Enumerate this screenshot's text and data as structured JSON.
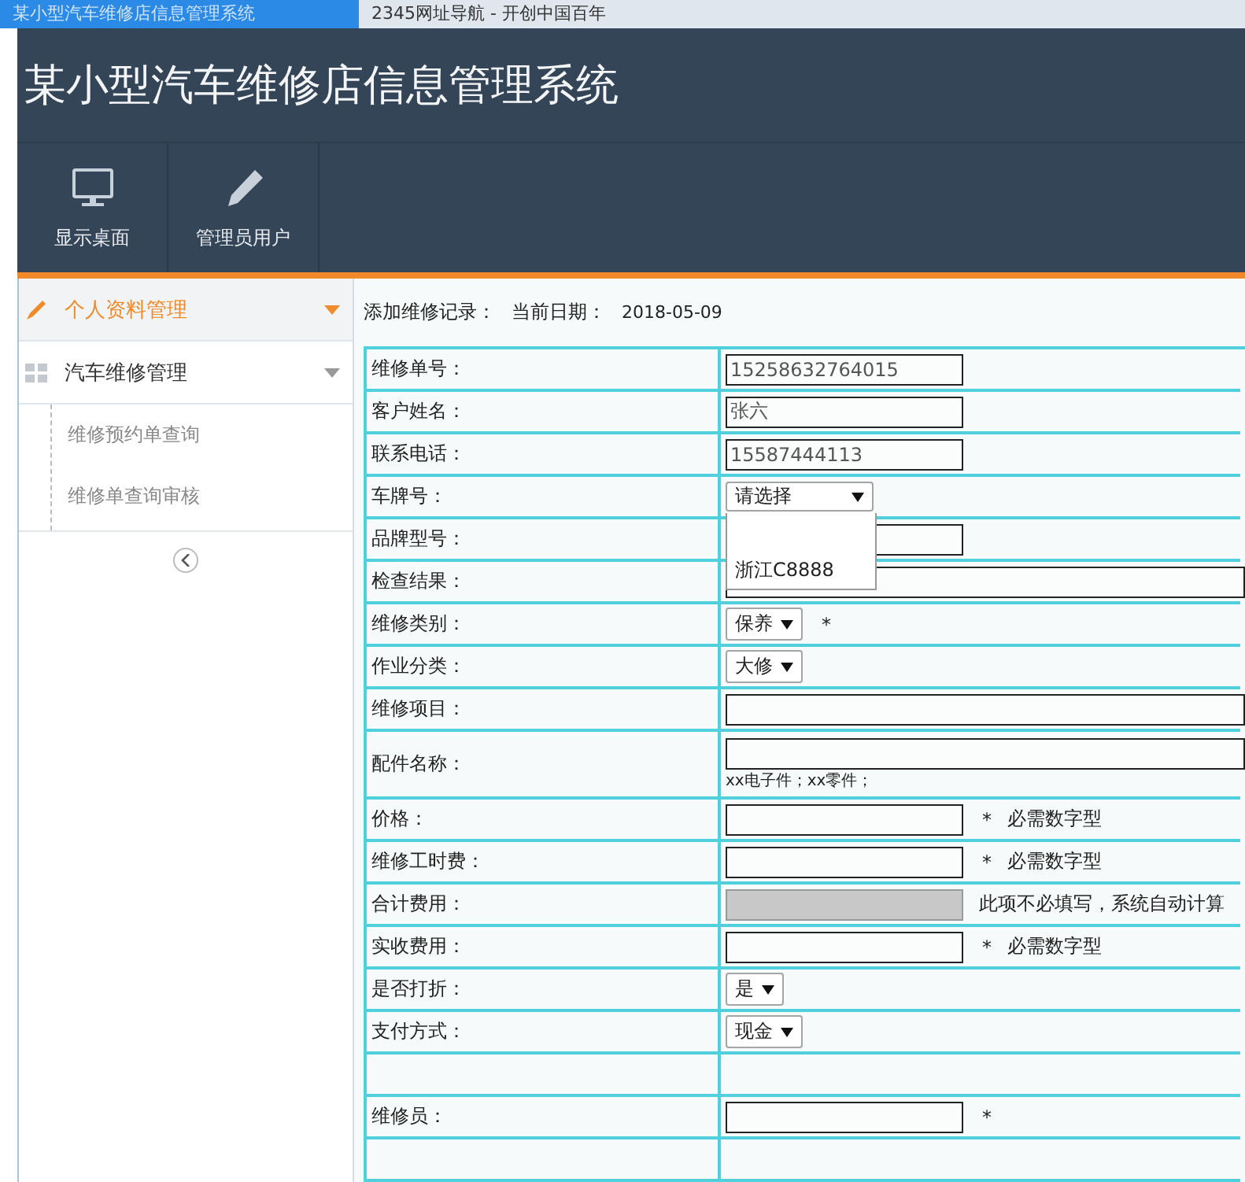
{
  "browser_tabs": [
    {
      "title": "某小型汽车维修店信息管理系统",
      "selected": true
    },
    {
      "title": "2345网址导航 - 开创中国百年",
      "selected": false
    }
  ],
  "header": {
    "title": "某小型汽车维修店信息管理系统"
  },
  "toolbar": [
    {
      "label": "显示桌面",
      "kind": "monitor"
    },
    {
      "label": "管理员用户",
      "kind": "pencil"
    }
  ],
  "sidebar": {
    "items": [
      {
        "label": "个人资料管理",
        "kind": "pencil",
        "selected": true,
        "expanded": false
      },
      {
        "label": "汽车维修管理",
        "kind": "grid",
        "selected": false,
        "expanded": true,
        "children": [
          {
            "label": "维修预约单查询"
          },
          {
            "label": "维修单查询审核"
          }
        ]
      }
    ]
  },
  "form": {
    "heading": "添加维修记录：",
    "date_label": "当前日期：",
    "date": "2018-05-09",
    "rows": [
      {
        "label": "维修单号：",
        "kind": "text",
        "value": "15258632764015"
      },
      {
        "label": "客户姓名：",
        "kind": "text",
        "value": "张六"
      },
      {
        "label": "联系电话：",
        "kind": "text",
        "value": "15587444113"
      },
      {
        "label": "车牌号：",
        "kind": "select",
        "value": "请选择",
        "open": true,
        "options": [
          "浙江C8888"
        ]
      },
      {
        "label": "品牌型号：",
        "kind": "text"
      },
      {
        "label": "检查结果：",
        "kind": "wide"
      },
      {
        "label": "维修类别：",
        "kind": "select",
        "value": "保养",
        "mark": "*"
      },
      {
        "label": "作业分类：",
        "kind": "select",
        "value": "大修"
      },
      {
        "label": "维修项目：",
        "kind": "wide"
      },
      {
        "label": "配件名称：",
        "kind": "wide",
        "hint": "xx电子件；xx零件；"
      },
      {
        "label": "价格：",
        "kind": "text",
        "mark": "*",
        "note": "必需数字型"
      },
      {
        "label": "维修工时费：",
        "kind": "text",
        "mark": "*",
        "note": "必需数字型"
      },
      {
        "label": "合计费用：",
        "kind": "readonly",
        "note": "此项不必填写，系统自动计算"
      },
      {
        "label": "实收费用：",
        "kind": "text",
        "mark": "*",
        "note": "必需数字型"
      },
      {
        "label": "是否打折：",
        "kind": "select",
        "value": "是"
      },
      {
        "label": "支付方式：",
        "kind": "select",
        "value": "现金"
      },
      {
        "kind": "blank"
      },
      {
        "label": "维修员：",
        "kind": "text",
        "mark": "*"
      },
      {
        "kind": "blank"
      }
    ]
  }
}
